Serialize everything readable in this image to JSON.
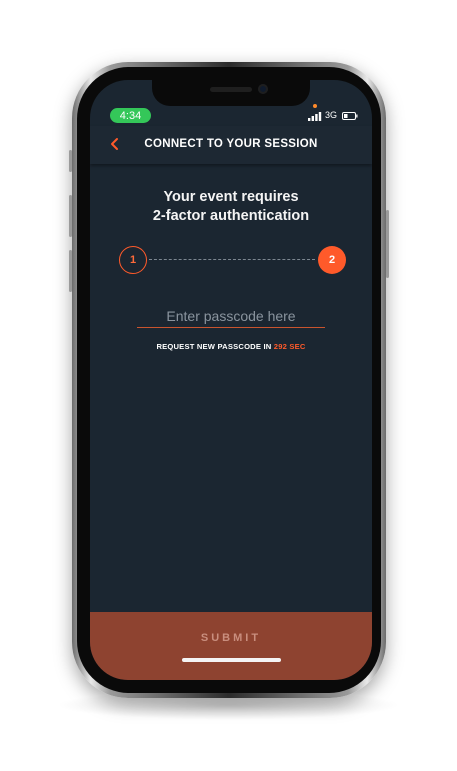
{
  "status_bar": {
    "time": "4:34",
    "network": "3G",
    "signal_icon": "cellular-signal-icon",
    "battery_icon": "battery-icon"
  },
  "header": {
    "back_icon": "chevron-left-icon",
    "title": "CONNECT TO YOUR SESSION"
  },
  "main": {
    "heading_line1": "Your event requires",
    "heading_line2": "2-factor authentication",
    "steps": [
      "1",
      "2"
    ],
    "active_step": 2,
    "passcode_placeholder": "Enter passcode here",
    "passcode_value": "",
    "request_prefix": "REQUEST NEW PASSCODE IN",
    "request_countdown": "292 SEC"
  },
  "footer": {
    "submit_label": "SUBMIT"
  },
  "colors": {
    "accent": "#ff5a2a",
    "background": "#1b2631",
    "submit_bg": "#8e4330",
    "time_pill": "#34c759"
  }
}
